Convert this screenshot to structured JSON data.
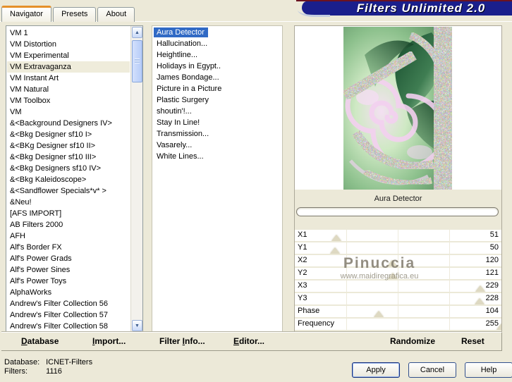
{
  "window": {
    "title": "Filters Unlimited 2.0"
  },
  "tabs": [
    {
      "label": "Navigator",
      "selected": true
    },
    {
      "label": "Presets"
    },
    {
      "label": "About"
    }
  ],
  "category_list": {
    "items": [
      {
        "label": "VM 1"
      },
      {
        "label": "VM Distortion"
      },
      {
        "label": "VM Experimental"
      },
      {
        "label": "VM Extravaganza",
        "selected": true
      },
      {
        "label": "VM Instant Art"
      },
      {
        "label": "VM Natural"
      },
      {
        "label": "VM Toolbox"
      },
      {
        "label": "VM"
      },
      {
        "label": "&<Background Designers IV>"
      },
      {
        "label": "&<Bkg Designer sf10 I>"
      },
      {
        "label": "&<BKg Designer sf10 II>"
      },
      {
        "label": "&<Bkg Designer sf10 III>"
      },
      {
        "label": "&<Bkg Designers sf10 IV>"
      },
      {
        "label": "&<Bkg Kaleidoscope>"
      },
      {
        "label": "&<Sandflower Specials*v* >"
      },
      {
        "label": "&Neu!"
      },
      {
        "label": "[AFS IMPORT]"
      },
      {
        "label": "AB Filters 2000"
      },
      {
        "label": "AFH"
      },
      {
        "label": "Alf's Border FX"
      },
      {
        "label": "Alf's Power Grads"
      },
      {
        "label": "Alf's Power Sines"
      },
      {
        "label": "Alf's Power Toys"
      },
      {
        "label": "AlphaWorks"
      },
      {
        "label": "Andrew's Filter Collection 56"
      },
      {
        "label": "Andrew's Filter Collection 57"
      },
      {
        "label": "Andrew's Filter Collection 58"
      }
    ]
  },
  "filter_list": {
    "items": [
      {
        "label": "Aura Detector",
        "selected": true
      },
      {
        "label": "Hallucination..."
      },
      {
        "label": "Heightline..."
      },
      {
        "label": "Holidays in Egypt.."
      },
      {
        "label": "James Bondage..."
      },
      {
        "label": "Picture in a Picture"
      },
      {
        "label": "Plastic Surgery"
      },
      {
        "label": "shoutin'!..."
      },
      {
        "label": "Stay In Line!"
      },
      {
        "label": "Transmission..."
      },
      {
        "label": "Vasarely..."
      },
      {
        "label": "White Lines..."
      }
    ]
  },
  "preview": {
    "caption": "Aura Detector",
    "watermark": {
      "line1": "Pinuccia",
      "line2": "www.maidiregrafica.eu"
    }
  },
  "sliders": {
    "max": 255,
    "items": [
      {
        "label": "X1",
        "value": 51
      },
      {
        "label": "Y1",
        "value": 50
      },
      {
        "label": "X2",
        "value": 120
      },
      {
        "label": "Y2",
        "value": 121
      },
      {
        "label": "X3",
        "value": 229
      },
      {
        "label": "Y3",
        "value": 228
      },
      {
        "label": "Phase",
        "value": 104
      },
      {
        "label": "Frequency",
        "value": 255
      }
    ]
  },
  "toolbar": {
    "left_items": [
      {
        "label": "Database",
        "accel": 0
      },
      {
        "label": "Import...",
        "accel": 0
      },
      {
        "label": "Filter Info...",
        "accel": 7
      },
      {
        "label": "Editor...",
        "accel": 0
      }
    ],
    "right_items": [
      {
        "label": "Randomize"
      },
      {
        "label": "Reset"
      }
    ]
  },
  "statusbar": {
    "database_label": "Database:",
    "database_value": "ICNET-Filters",
    "filters_label": "Filters:",
    "filters_value": "1116"
  },
  "actions": {
    "apply": "Apply",
    "cancel": "Cancel",
    "help": "Help"
  },
  "icons": {
    "scroll_up": "▲",
    "scroll_down": "▼"
  },
  "colors": {
    "dialog_bg": "#ece9d8",
    "selection_blue": "#316ac5",
    "banner_navy": "#1a1f8c",
    "tab_accent_orange": "#e5902a",
    "banner_top_maroon": "#6b1321"
  }
}
